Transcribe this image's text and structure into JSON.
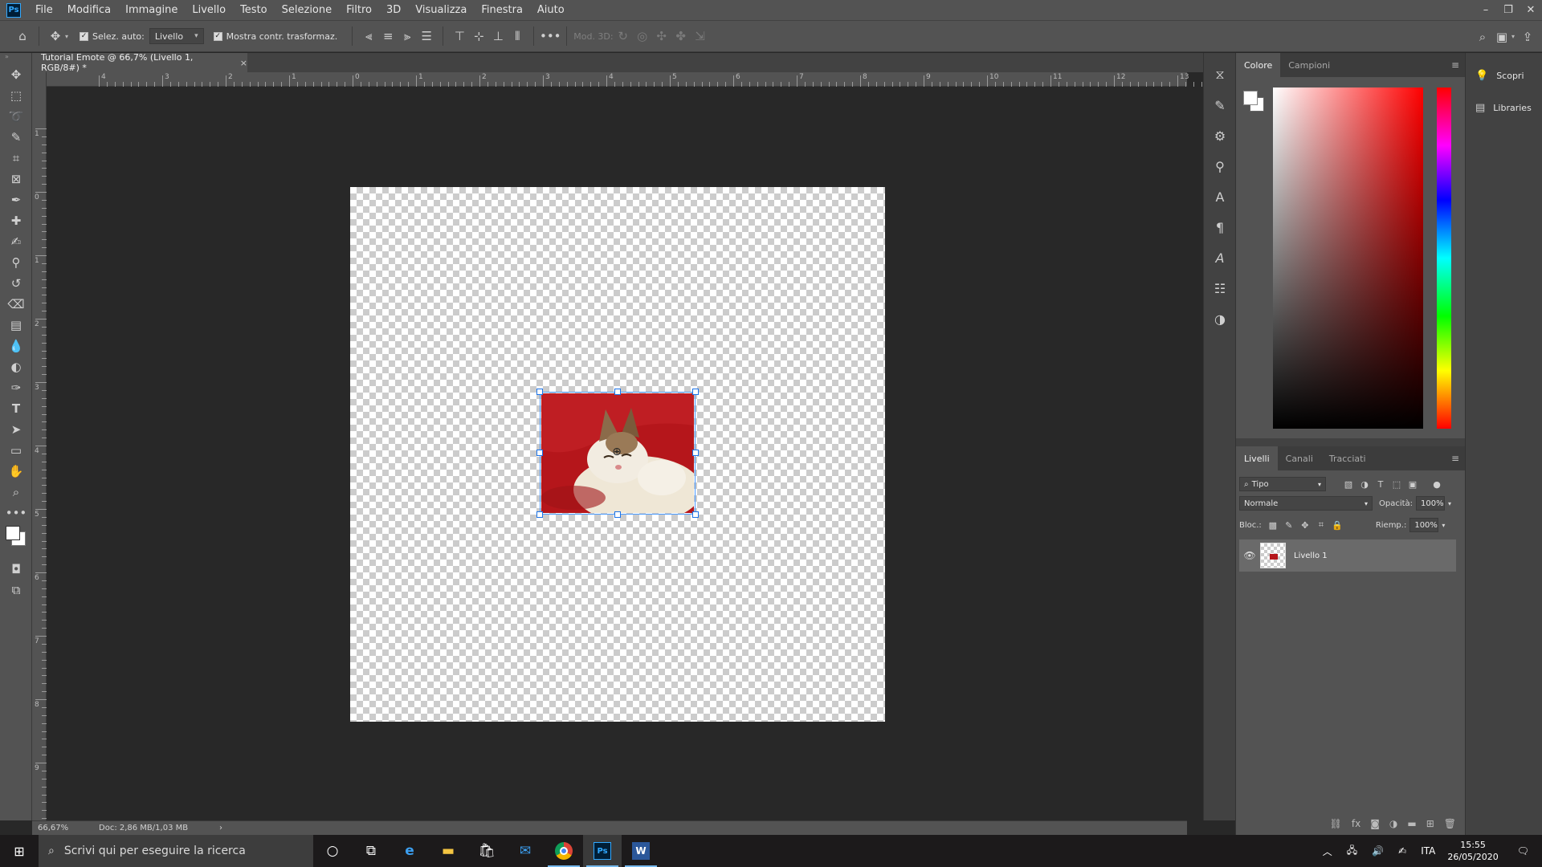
{
  "app": {
    "logo": "Ps"
  },
  "menu": [
    "File",
    "Modifica",
    "Immagine",
    "Livello",
    "Testo",
    "Selezione",
    "Filtro",
    "3D",
    "Visualizza",
    "Finestra",
    "Aiuto"
  ],
  "window_controls": {
    "minimize": "–",
    "restore": "❐",
    "close": "✕"
  },
  "options": {
    "auto_select_label": "Selez. auto:",
    "auto_select_value": "Livello",
    "show_transform_label": "Mostra contr. trasformaz.",
    "mode_3d_label": "Mod. 3D:"
  },
  "document": {
    "tab_title": "Tutorial Emote @ 66,7% (Livello 1, RGB/8#) *",
    "close": "×"
  },
  "rulers": {
    "h_labels": [
      "4",
      "3",
      "2",
      "1",
      "0",
      "1",
      "2",
      "3",
      "4",
      "5",
      "6",
      "7",
      "8",
      "9",
      "10",
      "11",
      "12",
      "13"
    ],
    "v_labels": [
      "1",
      "0",
      "1",
      "2",
      "3",
      "4",
      "5",
      "6",
      "7",
      "8",
      "9"
    ]
  },
  "status": {
    "zoom": "66,67%",
    "doc": "Doc: 2,86 MB/1,03 MB",
    "arrow": "›"
  },
  "color_panel": {
    "tabs": [
      "Colore",
      "Campioni"
    ]
  },
  "layers_panel": {
    "tabs": [
      "Livelli",
      "Canali",
      "Tracciati"
    ],
    "filter_kind": "Tipo",
    "blend_mode": "Normale",
    "opacity_label": "Opacità:",
    "opacity_value": "100%",
    "lock_label": "Bloc.:",
    "fill_label": "Riemp.:",
    "fill_value": "100%",
    "layers": [
      {
        "name": "Livello 1",
        "visible": true
      }
    ]
  },
  "side_panel": {
    "items": [
      "Scopri",
      "Libraries"
    ]
  },
  "taskbar": {
    "search_placeholder": "Scrivi qui per eseguire la ricerca",
    "language": "ITA",
    "time": "15:55",
    "date": "26/05/2020"
  },
  "icons": [
    "home-icon",
    "move-icon",
    "marquee-icon",
    "lasso-icon",
    "quick-select-icon",
    "crop-icon",
    "frame-icon",
    "eyedropper-icon",
    "healing-icon",
    "brush-icon",
    "stamp-icon",
    "history-brush-icon",
    "eraser-icon",
    "gradient-icon",
    "blur-icon",
    "dodge-icon",
    "pen-icon",
    "type-icon",
    "path-select-icon",
    "rectangle-icon",
    "hand-icon",
    "zoom-icon",
    "more-icon"
  ],
  "colors": {
    "accent": "#31a8ff",
    "canvas_image_bg": "#b5161b",
    "ui_panel": "#535353",
    "ui_dark": "#282828"
  }
}
